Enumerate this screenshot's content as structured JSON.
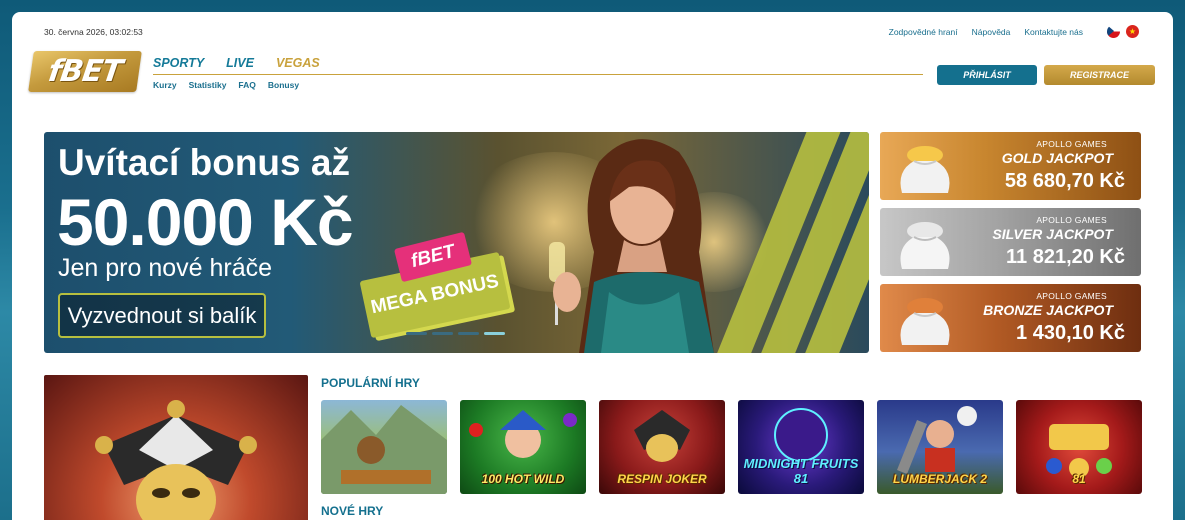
{
  "header": {
    "datetime": "30. června 2026, 03:02:53",
    "top_links": [
      "Zodpovědné hraní",
      "Nápověda",
      "Kontaktujte nás"
    ],
    "logo_text": "fBET",
    "main_nav": [
      "SPORTY",
      "LIVE",
      "VEGAS"
    ],
    "sub_nav": [
      "Kurzy",
      "Statistiky",
      "FAQ",
      "Bonusy"
    ],
    "login_label": "PŘIHLÁSIT",
    "register_label": "REGISTRACE",
    "flags": [
      "cz-flag",
      "vn-flag"
    ]
  },
  "hero": {
    "title": "Uvítací bonus až",
    "amount": "50.000 Kč",
    "subtitle": "Jen pro nové hráče",
    "cta": "Vyzvednout si balík",
    "badge_brand": "fBET",
    "badge_text": "MEGA BONUS",
    "slides_total": 4,
    "active_slide": 4
  },
  "jackpots": [
    {
      "provider": "APOLLO GAMES",
      "name": "GOLD JACKPOT",
      "amount": "58 680,70 Kč"
    },
    {
      "provider": "APOLLO GAMES",
      "name": "SILVER JACKPOT",
      "amount": "11 821,20 Kč"
    },
    {
      "provider": "APOLLO GAMES",
      "name": "BRONZE JACKPOT",
      "amount": "1 430,10 Kč"
    }
  ],
  "sections": {
    "popular_title": "POPULÁRNÍ HRY",
    "new_title": "NOVÉ HRY"
  },
  "popular_games": [
    {
      "label": ""
    },
    {
      "label": "100 HOT WILD"
    },
    {
      "label": "RESPIN JOKER"
    },
    {
      "label": "MIDNIGHT FRUITS 81"
    },
    {
      "label": "LUMBERJACK 2"
    },
    {
      "label": "81"
    }
  ],
  "colors": {
    "accent_teal": "#14708e",
    "accent_gold": "#c9a23c",
    "lime": "#b7bf3f"
  }
}
